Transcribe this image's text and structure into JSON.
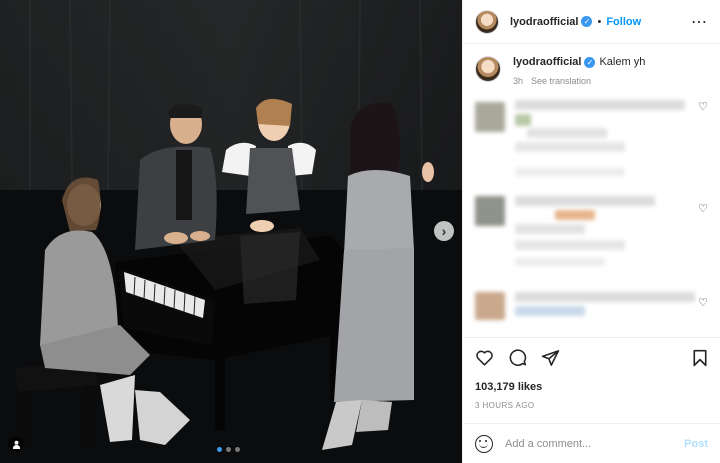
{
  "header": {
    "username": "lyodraofficial",
    "separator": "•",
    "follow_label": "Follow",
    "more_icon": "more-horizontal-icon"
  },
  "caption": {
    "username": "lyodraofficial",
    "text": "Kalem yh",
    "time_ago": "3h",
    "translate_label": "See translation"
  },
  "actions": {
    "like_icon": "heart-icon",
    "comment_icon": "comment-icon",
    "share_icon": "send-icon",
    "save_icon": "bookmark-icon"
  },
  "likes": "103,179 likes",
  "timestamp": "3 HOURS AGO",
  "add_comment": {
    "placeholder": "Add a comment...",
    "post_label": "Post"
  },
  "media": {
    "carousel_total": 3,
    "carousel_active": 1
  },
  "colors": {
    "accent": "#0095f6",
    "post_disabled": "#b2dffc",
    "text": "#262626",
    "muted": "#8e8e8e"
  }
}
